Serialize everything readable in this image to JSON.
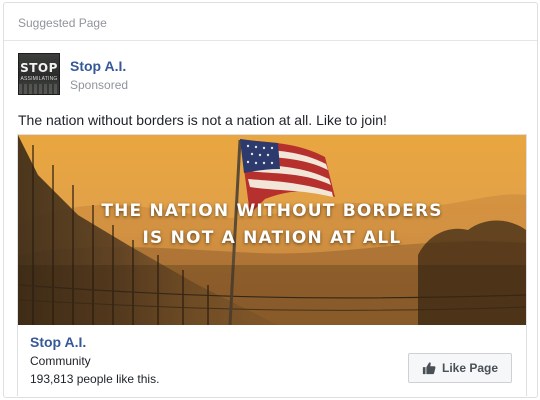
{
  "header": {
    "label": "Suggested Page"
  },
  "page": {
    "name": "Stop A.I.",
    "sponsored_label": "Sponsored",
    "avatar_title": "STOP",
    "avatar_subtitle": "ASSIMILATING"
  },
  "post": {
    "text": "The nation without borders is not a nation at all. Like to join!"
  },
  "image": {
    "line1": "THE NATION WITHOUT BORDERS",
    "line2": "IS NOT A NATION AT ALL"
  },
  "footer": {
    "name": "Stop A.I.",
    "category": "Community",
    "likes": "193,813 people like this.",
    "like_button": "Like Page",
    "like_icon": "thumbs-up-icon"
  },
  "colors": {
    "link": "#365899",
    "secondary_text": "#90949c",
    "sky": "#e6a647"
  }
}
